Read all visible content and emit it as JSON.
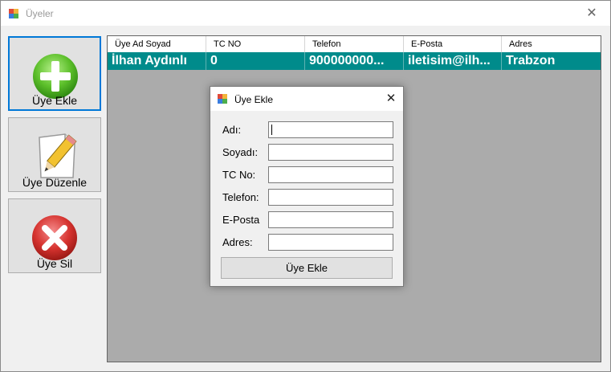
{
  "window": {
    "title": "Üyeler",
    "close_glyph": "✕"
  },
  "sidebar": {
    "add_label": "Üye Ekle",
    "add_icon": "plus-icon",
    "edit_label": "Üye Düzenle",
    "edit_icon": "pencil-icon",
    "delete_label": "Üye Sil",
    "delete_icon": "delete-x-icon"
  },
  "grid": {
    "columns": [
      "Üye Ad Soyad",
      "TC NO",
      "Telefon",
      "E-Posta",
      "Adres"
    ],
    "rows": [
      [
        "İlhan Aydınlı",
        "0",
        "900000000...",
        "iletisim@ilh...",
        "Trabzon"
      ]
    ],
    "selected_row_color": "#008b8b"
  },
  "dialog": {
    "title": "Üye Ekle",
    "close_glyph": "✕",
    "fields": [
      {
        "label": "Adı:",
        "value": ""
      },
      {
        "label": "Soyadı:",
        "value": ""
      },
      {
        "label": "TC No:",
        "value": ""
      },
      {
        "label": "Telefon:",
        "value": ""
      },
      {
        "label": "E-Posta",
        "value": ""
      },
      {
        "label": "Adres:",
        "value": ""
      }
    ],
    "submit_label": "Üye Ekle"
  }
}
